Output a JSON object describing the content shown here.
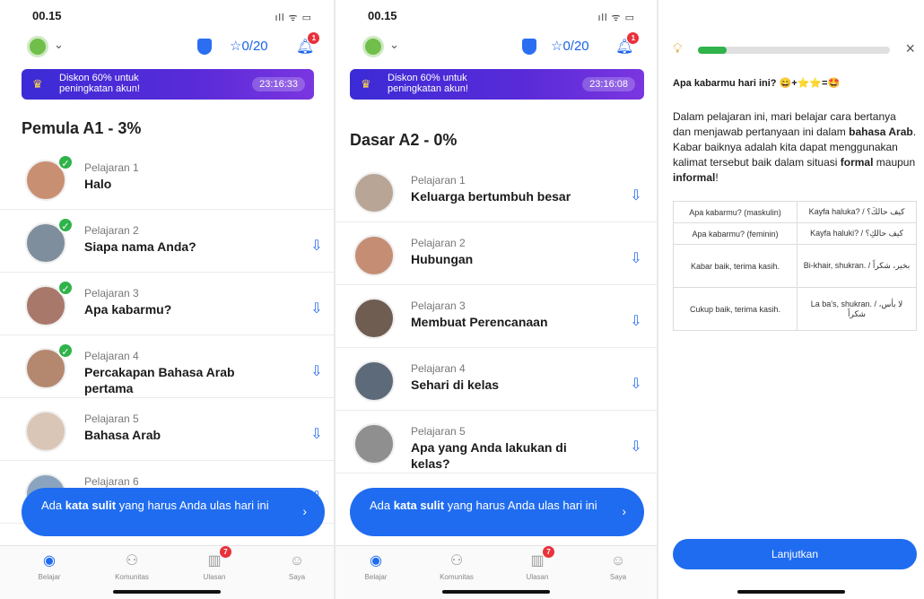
{
  "panels": [
    {
      "status_time": "00.15",
      "status_icons": "ıll ᯤ ▭",
      "stars": "☆0/20",
      "bell_badge": "1",
      "promo": {
        "text": "Diskon 60% untuk peningkatan akun!",
        "timer": "23:16:33"
      },
      "section_title": "Pemula A1 - 3%",
      "lessons": [
        {
          "num": "Pelajaran 1",
          "title": "Halo",
          "done": true,
          "download": false
        },
        {
          "num": "Pelajaran 2",
          "title": "Siapa nama Anda?",
          "done": true,
          "download": true
        },
        {
          "num": "Pelajaran 3",
          "title": "Apa kabarmu?",
          "done": true,
          "download": true
        },
        {
          "num": "Pelajaran 4",
          "title": "Percakapan Bahasa Arab pertama",
          "done": true,
          "download": true
        },
        {
          "num": "Pelajaran 5",
          "title": "Bahasa Arab",
          "done": false,
          "download": true
        },
        {
          "num": "Pelajaran 6",
          "title": "",
          "done": false,
          "download": true
        }
      ],
      "review": {
        "pre": "Ada ",
        "bold": "kata sulit",
        "post": " yang harus Anda ulas hari ini",
        "arrow": "›"
      },
      "tabs": [
        {
          "label": "Belajar",
          "icon": "globe-icon"
        },
        {
          "label": "Komunitas",
          "icon": "community-icon"
        },
        {
          "label": "Ulasan",
          "icon": "review-icon",
          "badge": "7"
        },
        {
          "label": "Saya",
          "icon": "profile-icon"
        }
      ]
    },
    {
      "status_time": "00.15",
      "status_icons": "ıll ᯤ ▭",
      "stars": "☆0/20",
      "bell_badge": "1",
      "promo": {
        "text": "Diskon 60% untuk peningkatan akun!",
        "timer": "23:16:08"
      },
      "section_title": "Dasar A2 - 0%",
      "lessons": [
        {
          "num": "Pelajaran 1",
          "title": "Keluarga bertumbuh besar",
          "done": false,
          "download": true
        },
        {
          "num": "Pelajaran 2",
          "title": "Hubungan",
          "done": false,
          "download": true
        },
        {
          "num": "Pelajaran 3",
          "title": "Membuat Perencanaan",
          "done": false,
          "download": true
        },
        {
          "num": "Pelajaran 4",
          "title": "Sehari di kelas",
          "done": false,
          "download": true
        },
        {
          "num": "Pelajaran 5",
          "title": "Apa yang Anda lakukan di kelas?",
          "done": false,
          "download": true
        }
      ],
      "review": {
        "pre": "Ada ",
        "bold": "kata sulit",
        "post": " yang harus Anda ulas hari ini",
        "arrow": "›"
      },
      "tabs": [
        {
          "label": "Belajar",
          "icon": "globe-icon"
        },
        {
          "label": "Komunitas",
          "icon": "community-icon"
        },
        {
          "label": "Ulasan",
          "icon": "review-icon",
          "badge": "7"
        },
        {
          "label": "Saya",
          "icon": "profile-icon"
        }
      ]
    }
  ],
  "lesson_detail": {
    "progress_fraction": 0.15,
    "close": "×",
    "question": "Apa kabarmu hari ini? 😄+⭐⭐=🤩",
    "intro": {
      "p1": "Dalam pelajaran ini, mari belajar cara bertanya dan menjawab pertanyaan ini dalam ",
      "b1": "bahasa Arab",
      "p2": ". Kabar baiknya adalah kita dapat menggunakan kalimat tersebut baik dalam situasi ",
      "b2": "formal",
      "p3": " maupun ",
      "b3": "informal",
      "p4": "!"
    },
    "table": [
      [
        "Apa kabarmu? (maskulin)",
        "Kayfa haluka? / كيف حالكَ؟"
      ],
      [
        "Apa kabarmu? (feminin)",
        "Kayfa haluki? / كيف حالكِ؟"
      ],
      [
        "Kabar baik, terima kasih.",
        "Bi-khair, shukran. / بخير، شكراً"
      ],
      [
        "Cukup baik, terima kasih.",
        "La ba's, shukran. / لا بأس، شكراً"
      ]
    ],
    "continue_label": "Lanjutkan"
  },
  "colors": {
    "accent": "#1f6cf0",
    "success": "#2fb34a",
    "badge": "#e8323c"
  }
}
